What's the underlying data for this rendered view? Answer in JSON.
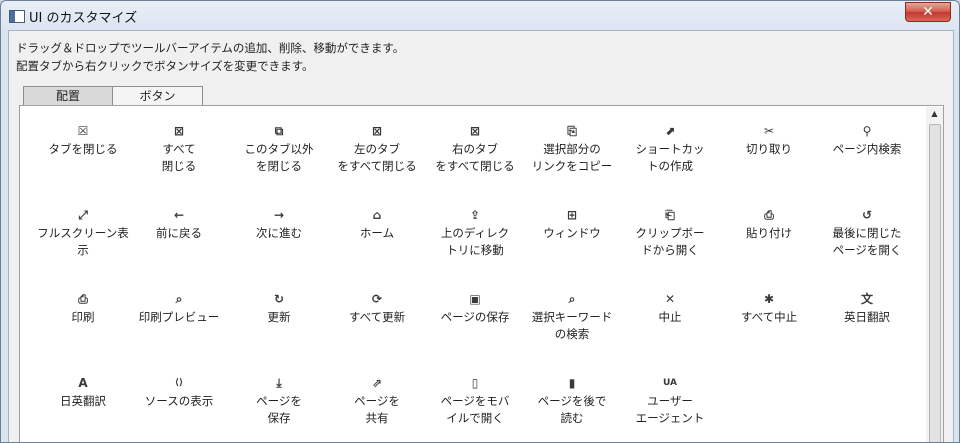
{
  "window": {
    "title": "UI のカスタマイズ",
    "close_glyph": "✕"
  },
  "description": {
    "line1": "ドラッグ＆ドロップでツールバーアイテムの追加、削除、移動ができます。",
    "line2": "配置タブから右クリックでボタンサイズを変更できます。"
  },
  "tabs": [
    {
      "label": "配置"
    },
    {
      "label": "ボタン"
    }
  ],
  "scrollbar": {
    "up_arrow": "▲"
  },
  "items": [
    {
      "label": "タブを閉じる",
      "icon": "close-tab-icon"
    },
    {
      "label": "すべて\n閉じる",
      "icon": "close-all-icon"
    },
    {
      "label": "このタブ以外\nを閉じる",
      "icon": "close-others-icon"
    },
    {
      "label": "左のタブ\nをすべて閉じる",
      "icon": "close-left-icon"
    },
    {
      "label": "右のタブ\nをすべて閉じる",
      "icon": "close-right-icon"
    },
    {
      "label": "選択部分の\nリンクをコピー",
      "icon": "copy-link-icon"
    },
    {
      "label": "ショートカッ\nトの作成",
      "icon": "shortcut-icon"
    },
    {
      "label": "切り取り",
      "icon": "scissors-icon"
    },
    {
      "label": "ページ内検索",
      "icon": "search-icon"
    },
    {
      "label": "フルスクリーン表示",
      "icon": "fullscreen-icon"
    },
    {
      "label": "前に戻る",
      "icon": "arrow-left-icon"
    },
    {
      "label": "次に進む",
      "icon": "arrow-right-icon"
    },
    {
      "label": "ホーム",
      "icon": "home-icon"
    },
    {
      "label": "上のディレク\nトリに移動",
      "icon": "folder-up-icon"
    },
    {
      "label": "ウィンドウ",
      "icon": "new-window-icon"
    },
    {
      "label": "クリップボー\nドから開く",
      "icon": "clipboard-open-icon"
    },
    {
      "label": "貼り付け",
      "icon": "paste-icon"
    },
    {
      "label": "最後に閉じた\nページを開く",
      "icon": "history-icon"
    },
    {
      "label": "印刷",
      "icon": "print-icon"
    },
    {
      "label": "印刷プレビュー",
      "icon": "print-preview-icon"
    },
    {
      "label": "更新",
      "icon": "refresh-icon"
    },
    {
      "label": "すべて更新",
      "icon": "refresh-all-icon"
    },
    {
      "label": "ページの保存",
      "icon": "save-icon"
    },
    {
      "label": "選択キーワード\nの検索",
      "icon": "keyword-search-icon"
    },
    {
      "label": "中止",
      "icon": "stop-icon"
    },
    {
      "label": "すべて中止",
      "icon": "stop-all-icon"
    },
    {
      "label": "英日翻訳",
      "icon": "translate-en-ja-icon"
    },
    {
      "label": "日英翻訳",
      "icon": "translate-ja-en-icon"
    },
    {
      "label": "ソースの表示",
      "icon": "view-source-icon"
    },
    {
      "label": "ページを\n保存",
      "icon": "save-page-icon"
    },
    {
      "label": "ページを\n共有",
      "icon": "share-icon"
    },
    {
      "label": "ページをモバ\nイルで開く",
      "icon": "mobile-open-icon"
    },
    {
      "label": "ページを後で\n読む",
      "icon": "read-later-icon"
    },
    {
      "label": "ユーザー\nエージェント",
      "icon": "user-agent-icon"
    }
  ]
}
